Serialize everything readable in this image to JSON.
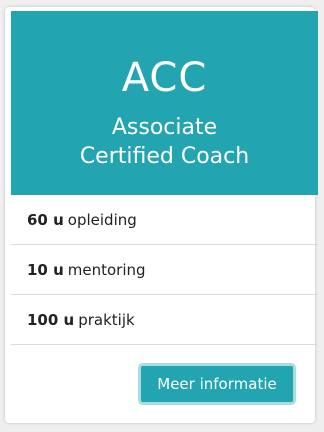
{
  "card": {
    "title": "ACC",
    "subtitle_line1": "Associate",
    "subtitle_line2": "Certified Coach",
    "items": [
      {
        "amount": "60 u",
        "label": "opleiding"
      },
      {
        "amount": "10 u",
        "label": "mentoring"
      },
      {
        "amount": "100 u",
        "label": "praktijk"
      }
    ],
    "button_label": "Meer informatie"
  },
  "colors": {
    "accent": "#22a5b1",
    "button_border": "#a7dde2",
    "background": "#efefef"
  }
}
